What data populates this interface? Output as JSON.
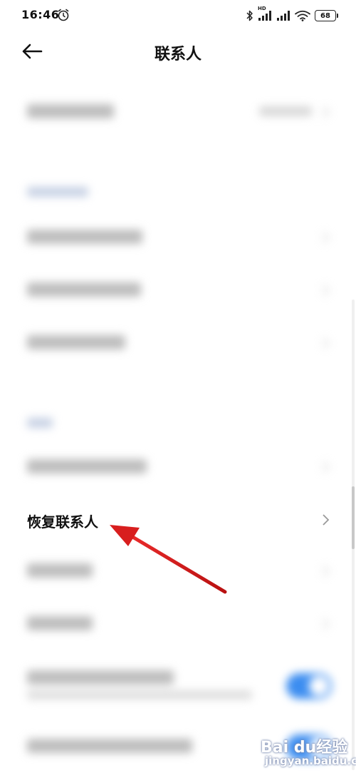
{
  "status_bar": {
    "time": "16:46",
    "battery": "68",
    "hd_badge": "HD"
  },
  "title_bar": {
    "title": "联系人"
  },
  "list": {
    "restore_contacts_label": "恢复联系人"
  },
  "watermark": {
    "logo": "Bai du经验",
    "sub": "jingyan.baidu.c"
  },
  "colors": {
    "toggle_on": "#3c8df0",
    "annotation_arrow": "#d81e1e",
    "section_header": "#8a9bb8"
  }
}
